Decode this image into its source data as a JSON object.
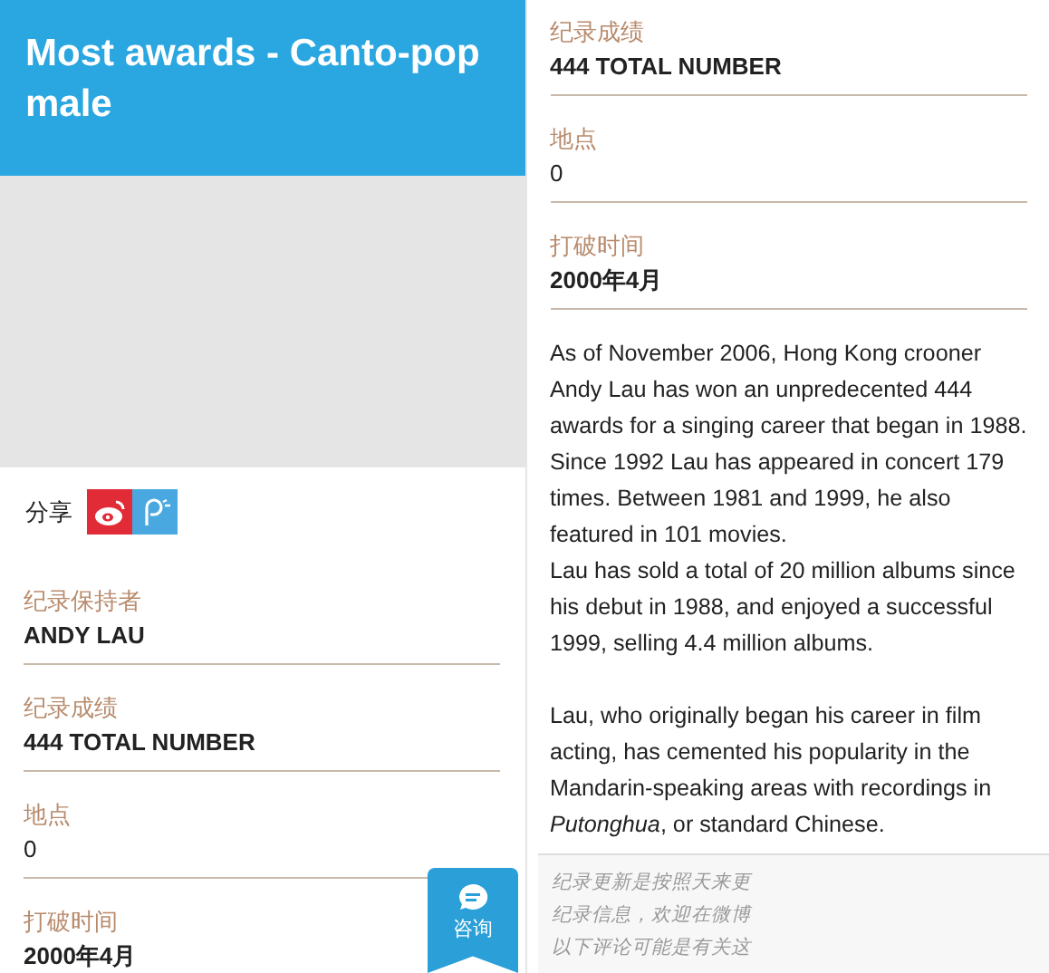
{
  "left": {
    "title": "Most awards - Canto-pop male",
    "share": {
      "label": "分享",
      "buttons": [
        {
          "kind": "weibo"
        },
        {
          "kind": "pengyou"
        }
      ]
    },
    "fields": [
      {
        "label": "纪录保持者",
        "value": "ANDY LAU",
        "bold": true
      },
      {
        "label": "纪录成绩",
        "value": "444 TOTAL NUMBER",
        "bold": true
      },
      {
        "label": "地点",
        "value": "0",
        "bold": false
      },
      {
        "label": "打破时间",
        "value": "2000年4月",
        "bold": true
      }
    ],
    "consult_button": {
      "label": "咨询"
    }
  },
  "right": {
    "fields": [
      {
        "label": "纪录成绩",
        "value": "444 TOTAL NUMBER",
        "bold": true
      },
      {
        "label": "地点",
        "value": "0",
        "bold": false
      },
      {
        "label": "打破时间",
        "value": "2000年4月",
        "bold": true
      }
    ],
    "sections": [
      [
        "As of November 2006, Hong Kong crooner Andy Lau has won an unpredecented 444 awards for a singing career that began in 1988. Since 1992 Lau has appeared in concert 179 times. Between 1981 and 1999, he also featured in 101 movies.",
        "Lau has sold a total of 20 million albums since his debut in 1988, and enjoyed a successful 1999, selling 4.4 million albums."
      ],
      [
        "Lau, who originally began his career in film acting, has cemented his popularity in the Mandarin-speaking areas with recordings in *Putonghua*, or standard Chinese."
      ]
    ],
    "notes": [
      "纪录更新是按照天来更",
      "纪录信息，欢迎在微博",
      "以下评论可能是有关这"
    ]
  }
}
